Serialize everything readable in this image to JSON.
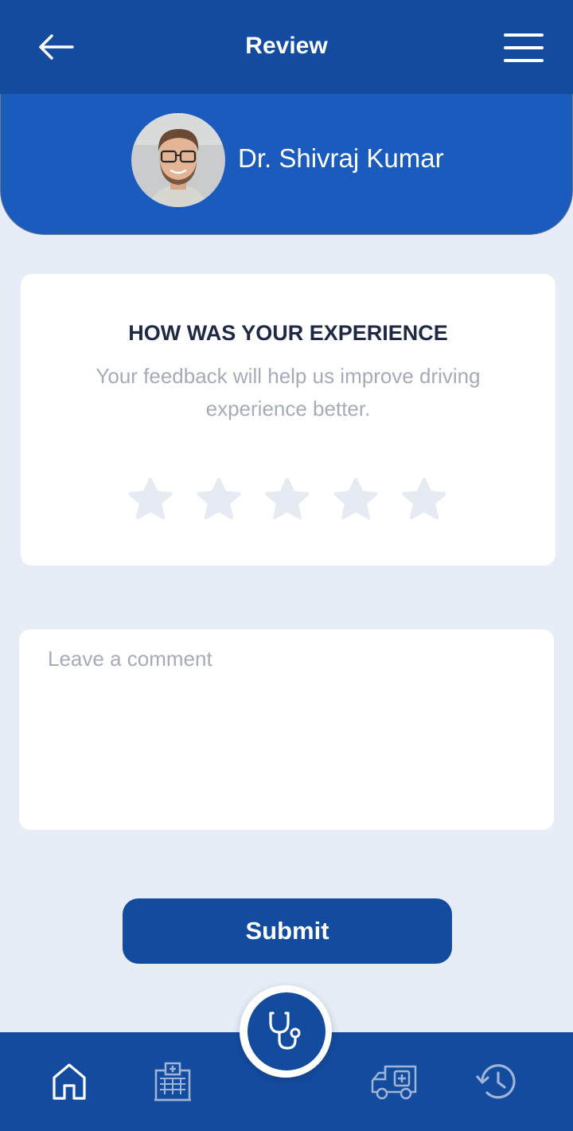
{
  "app_bar": {
    "title": "Review",
    "back_icon": "arrow-left-icon",
    "menu_icon": "hamburger-menu-icon"
  },
  "doctor": {
    "name": "Dr. Shivraj Kumar"
  },
  "experience": {
    "title": "HOW WAS YOUR EXPERIENCE",
    "subtitle": "Your feedback will help us improve driving experience better.",
    "rating": 0,
    "max_rating": 5
  },
  "comment": {
    "placeholder": "Leave a comment"
  },
  "submit": {
    "label": "Submit"
  },
  "bottom_nav": {
    "items": [
      {
        "icon": "home-icon"
      },
      {
        "icon": "hospital-icon"
      },
      {
        "icon": "stethoscope-icon"
      },
      {
        "icon": "ambulance-icon"
      },
      {
        "icon": "history-icon"
      }
    ]
  },
  "colors": {
    "primary": "#134C9F",
    "header": "#1B5BBE",
    "background": "#E6EDF6",
    "star_empty": "#E6EBF3",
    "title_text": "#1E2A45",
    "muted_text": "#A5ABB9"
  }
}
